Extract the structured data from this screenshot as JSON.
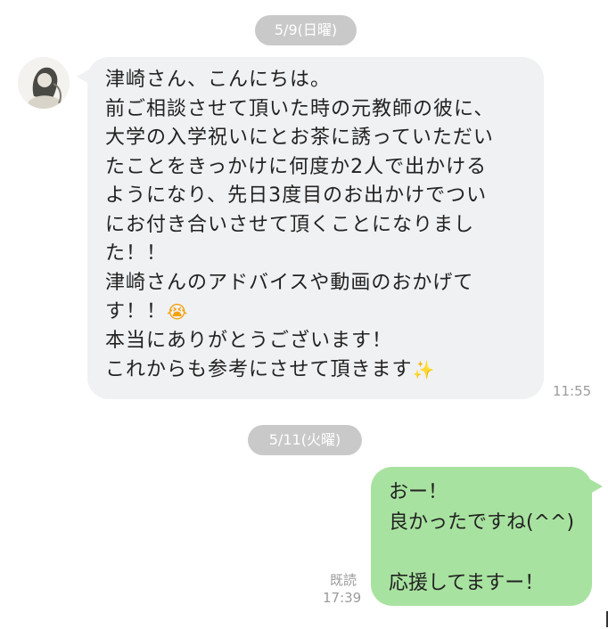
{
  "dates": {
    "first": "5/9(日曜)",
    "second": "5/11(火曜)"
  },
  "incoming": {
    "lines": [
      "津崎さん、こんにちは。",
      "前ご相談させて頂いた時の元教師の彼に、",
      "大学の入学祝いにとお茶に誘っていただい",
      "たことをきっかけに何度か2人で出かける",
      "ようになり、先日3度目のお出かけでつい",
      "にお付き合いさせて頂くことになりまし",
      "た！！",
      "津崎さんのアドバイスや動画のおかげて",
      "す！！",
      "本当にありがとうございます！",
      "これからも参考にさせて頂きます"
    ],
    "emoji_sad": "😭",
    "emoji_sparkle": "✨",
    "time": "11:55"
  },
  "outgoing": {
    "lines": [
      "おー！",
      "良かったですね(^^)",
      "",
      "応援してますー！"
    ],
    "read_label": "既読",
    "time": "17:39"
  },
  "colors": {
    "incoming_bubble": "#f0f1f3",
    "outgoing_bubble": "#a8e2a0",
    "date_pill": "#c9c9c9",
    "meta_text": "#9b9b9b"
  }
}
